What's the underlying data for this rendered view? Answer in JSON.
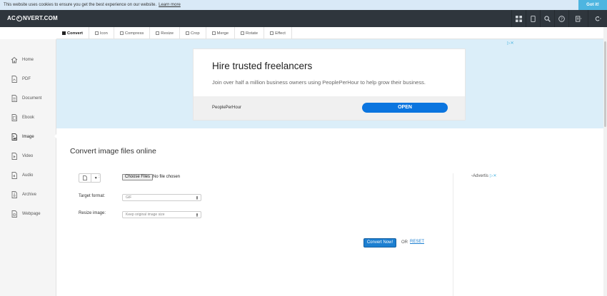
{
  "cookie": {
    "message": "This website uses cookies to ensure you get the best experience on our website.",
    "learn_more": "Learn more",
    "got_it": "Got it!"
  },
  "header": {
    "logo_left": "AC",
    "logo_right": "NVERT.COM",
    "icons": [
      "grid-icon",
      "tablet-icon",
      "search-icon",
      "help-icon",
      "bookmark-dropdown-icon",
      "refresh-dropdown-icon"
    ]
  },
  "tabs": [
    {
      "label": "Convert",
      "active": true
    },
    {
      "label": "Icon"
    },
    {
      "label": "Compress"
    },
    {
      "label": "Resize"
    },
    {
      "label": "Crop"
    },
    {
      "label": "Merge"
    },
    {
      "label": "Rotate"
    },
    {
      "label": "Effect"
    }
  ],
  "sidebar": {
    "items": [
      {
        "label": "Home",
        "icon": "home-icon"
      },
      {
        "label": "PDF",
        "icon": "pdf-file-icon"
      },
      {
        "label": "Document",
        "icon": "document-icon"
      },
      {
        "label": "Ebook",
        "icon": "ebook-icon"
      },
      {
        "label": "Image",
        "icon": "image-icon",
        "active": true
      },
      {
        "label": "Video",
        "icon": "video-icon"
      },
      {
        "label": "Audio",
        "icon": "audio-icon"
      },
      {
        "label": "Archive",
        "icon": "archive-icon"
      },
      {
        "label": "Webpage",
        "icon": "webpage-icon"
      }
    ]
  },
  "ad": {
    "title": "Hire trusted freelancers",
    "subtitle": "Join over half a million business owners using PeoplePerHour to help grow their business.",
    "brand": "PeoplePerHour",
    "cta": "OPEN",
    "close": "▷✕"
  },
  "main": {
    "title": "Convert image files online",
    "source_colon": ":",
    "choose_files": "Choose Files",
    "no_file": "No file chosen",
    "target_label": "Target format:",
    "target_value": "GIF",
    "resize_label": "Resize image:",
    "resize_value": "Keep original image size",
    "convert_button": "Convert Now!",
    "or": "OR",
    "reset": "RESET"
  },
  "side_ad": {
    "alt": "Advertis",
    "close": "▷✕"
  },
  "colors": {
    "navbar": "#2f363d",
    "accent": "#1c7fd1",
    "ad_band": "#dbeef9",
    "cookie_bar": "#d9e9f7"
  }
}
